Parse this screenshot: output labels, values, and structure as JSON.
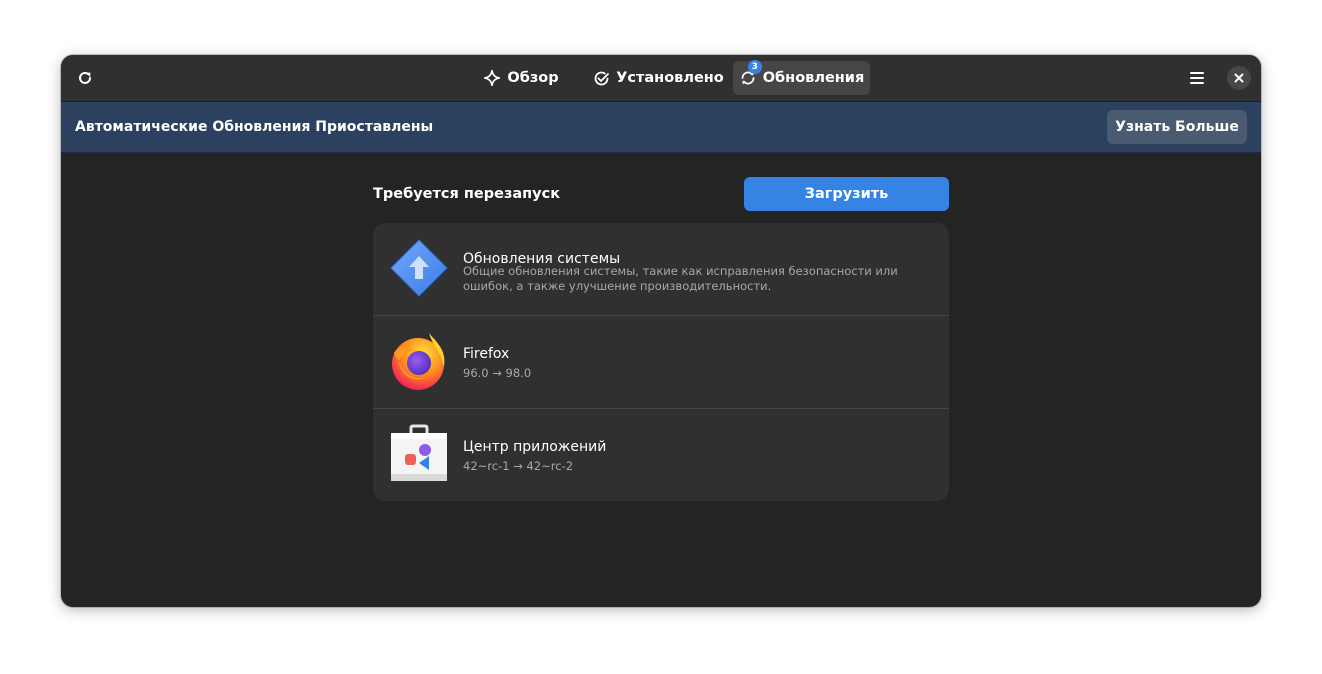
{
  "header": {
    "tabs": [
      {
        "label": "Обзор",
        "icon": "sparkle-icon"
      },
      {
        "label": "Установлено",
        "icon": "check-circle-icon"
      },
      {
        "label": "Обновления",
        "icon": "refresh-icon",
        "badge": "3",
        "active": true
      }
    ]
  },
  "banner": {
    "text": "Автоматические Обновления Приоставлены",
    "button_label": "Узнать Больше"
  },
  "updates": {
    "section_title": "Требуется перезапуск",
    "download_label": "Загрузить",
    "items": [
      {
        "title": "Обновления системы",
        "description": "Общие обновления системы, такие как исправления безопасности или ошибок, а также улучшение производительности.",
        "icon": "system-update-icon"
      },
      {
        "title": "Firefox",
        "version": "96.0 → 98.0",
        "icon": "firefox-icon"
      },
      {
        "title": "Центр приложений",
        "version": "42~rc-1 → 42~rc-2",
        "icon": "software-center-icon"
      }
    ]
  },
  "colors": {
    "accent": "#3584e4",
    "banner": "#2c4160",
    "window_bg": "#242424",
    "card_bg": "#303030"
  }
}
